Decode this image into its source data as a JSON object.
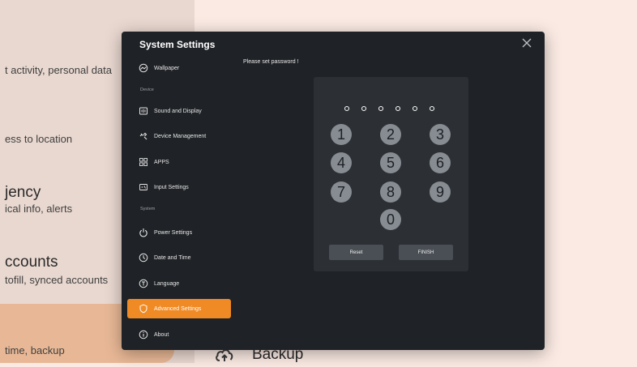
{
  "background": {
    "lines": [
      "t activity, personal data",
      "ess to location",
      "jency",
      "ical info, alerts",
      "ccounts",
      "tofill, synced accounts",
      "time, backup"
    ],
    "backup_label": "Backup",
    "backup_icon": "cloud-upload-icon"
  },
  "dialog": {
    "title": "System Settings",
    "close_icon": "close-icon",
    "prompt": "Please set password !",
    "sidebar": {
      "items": [
        {
          "label": "Wallpaper",
          "icon": "wallpaper-icon"
        },
        {
          "label": "Device",
          "type": "section"
        },
        {
          "label": "Sound and Display",
          "icon": "sound-display-icon"
        },
        {
          "label": "Device Management",
          "icon": "device-management-icon"
        },
        {
          "label": "APPS",
          "icon": "apps-icon"
        },
        {
          "label": "Input Settings",
          "icon": "input-settings-icon"
        },
        {
          "label": "System",
          "type": "section"
        },
        {
          "label": "Power Settings",
          "icon": "power-icon"
        },
        {
          "label": "Date and Time",
          "icon": "clock-icon"
        },
        {
          "label": "Language",
          "icon": "language-icon"
        },
        {
          "label": "Advanced Settings",
          "icon": "shield-icon",
          "active": true
        },
        {
          "label": "About",
          "icon": "info-icon"
        }
      ]
    },
    "keypad": {
      "dots": 6,
      "keys": [
        "1",
        "2",
        "3",
        "4",
        "5",
        "6",
        "7",
        "8",
        "9",
        "0"
      ],
      "reset_label": "Reset",
      "finish_label": "FINISH"
    },
    "accent_color": "#f08a24"
  }
}
